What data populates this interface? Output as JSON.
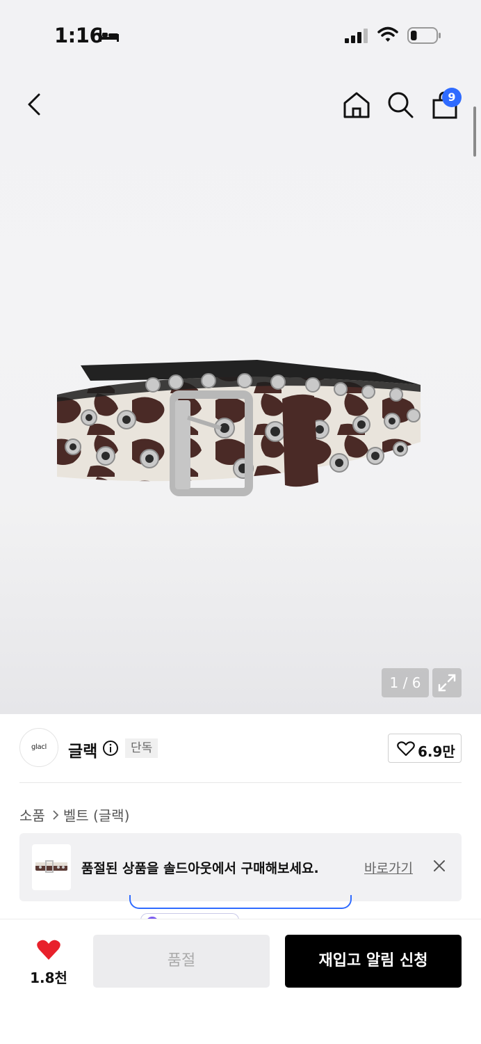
{
  "status_bar": {
    "time": "1:16",
    "battery_level": 0.25
  },
  "header": {
    "cart_count": "9"
  },
  "gallery": {
    "counter": "1 / 6"
  },
  "brand": {
    "logo_text": "glacl",
    "name": "글랙",
    "tag": "단독",
    "likes": "6.9만"
  },
  "breadcrumb": {
    "category": "소품",
    "subcategory": "벨트 (글랙)"
  },
  "soldout_banner": {
    "message": "품절된 상품을 솔드아웃에서 구매해보세요.",
    "link": "바로가기"
  },
  "bottom_bar": {
    "wish_count": "1.8천",
    "soldout_label": "품절",
    "restock_label": "재입고 알림 신청"
  },
  "colors": {
    "accent_blue": "#2f6bff",
    "heart_red": "#e8212b",
    "primary_black": "#000000"
  }
}
